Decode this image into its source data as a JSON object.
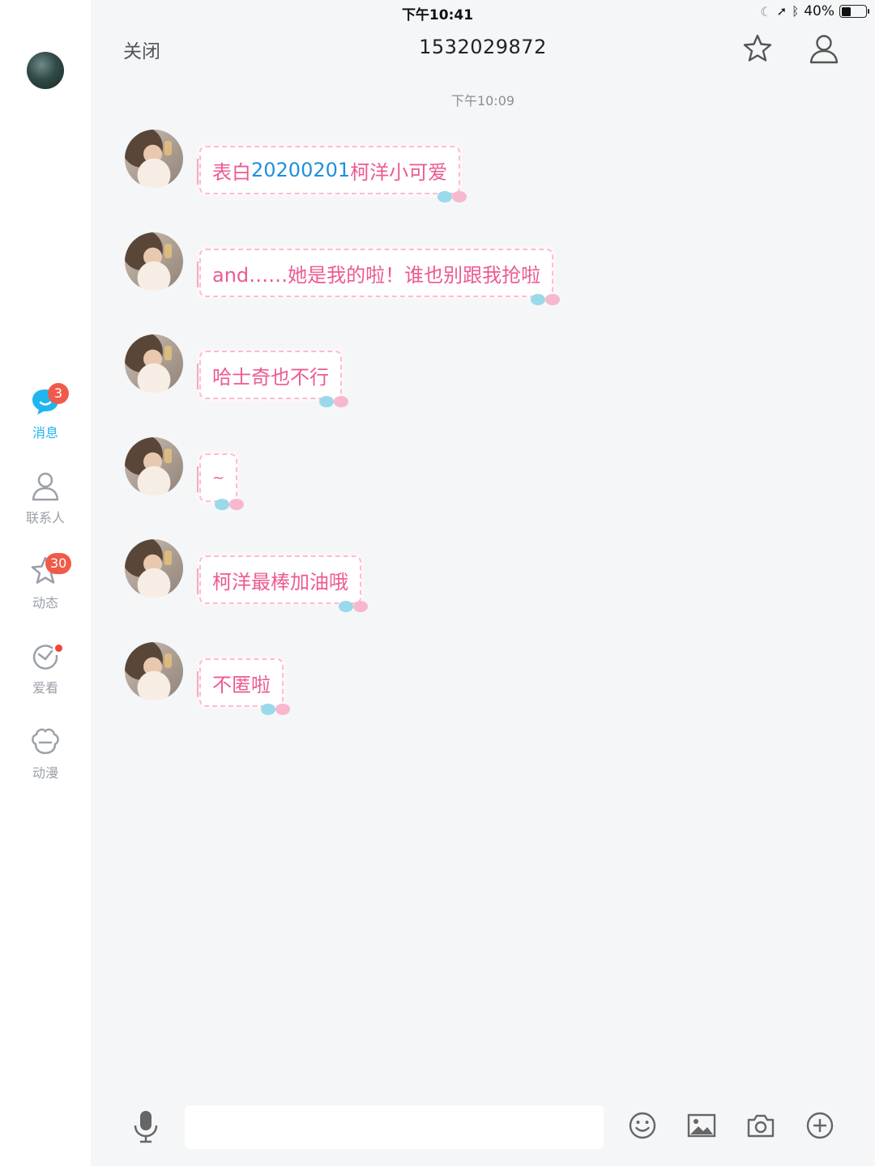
{
  "status_bar": {
    "device": "iPad",
    "time": "下午10:41",
    "battery": "40%",
    "battery_level": 0.4
  },
  "sidebar": {
    "items": [
      {
        "label": "消息",
        "badge": "3",
        "icon": "message-bubble-icon",
        "active": true
      },
      {
        "label": "联系人",
        "icon": "contacts-icon"
      },
      {
        "label": "动态",
        "badge": "30",
        "icon": "star-icon"
      },
      {
        "label": "爱看",
        "icon": "watch-icon",
        "dot": true
      },
      {
        "label": "动漫",
        "icon": "anime-icon"
      }
    ]
  },
  "header": {
    "close_label": "关闭",
    "title": "1532029872",
    "icons": [
      "favorite-star-icon",
      "profile-icon"
    ]
  },
  "chat": {
    "timestamp": "下午10:09",
    "messages": [
      {
        "pre": "表白",
        "highlight": "20200201",
        "post": "柯洋小可爱"
      },
      {
        "pre": "and……她是我的啦！谁也别跟我抢啦",
        "highlight": "",
        "post": ""
      },
      {
        "pre": "哈士奇也不行",
        "highlight": "",
        "post": ""
      },
      {
        "pre": "~",
        "highlight": "",
        "post": ""
      },
      {
        "pre": "柯洋最棒加油哦",
        "highlight": "",
        "post": ""
      },
      {
        "pre": "不匿啦",
        "highlight": "",
        "post": ""
      }
    ]
  },
  "input_bar": {
    "placeholder": "",
    "icons": [
      "microphone-icon",
      "emoji-icon",
      "image-icon",
      "camera-icon",
      "add-icon"
    ]
  },
  "colors": {
    "accent": "#1fb6f0",
    "badge": "#f05a4a",
    "bubble_text": "#ec5a93",
    "highlight_text": "#1f8fe0"
  }
}
